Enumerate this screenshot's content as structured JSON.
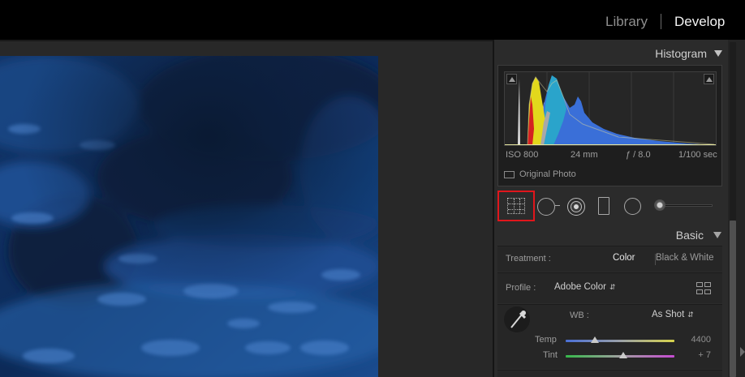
{
  "modules": {
    "library": "Library",
    "develop": "Develop"
  },
  "histogram": {
    "title": "Histogram",
    "iso": "ISO 800",
    "focal": "24 mm",
    "aperture": "ƒ / 8.0",
    "shutter": "1/100 sec",
    "original_photo_label": "Original Photo"
  },
  "tools": {
    "crop": "crop-overlay-icon",
    "spot": "spot-removal-icon",
    "redeye": "red-eye-icon",
    "graduated": "graduated-filter-icon",
    "radial": "radial-filter-icon",
    "brush": "adjustment-brush-icon"
  },
  "basic": {
    "title": "Basic",
    "treatment_label": "Treatment :",
    "treatment_color": "Color",
    "treatment_bw": "Black & White",
    "profile_label": "Profile :",
    "profile_value": "Adobe Color",
    "wb_label": "WB :",
    "wb_value": "As Shot",
    "temp_label": "Temp",
    "temp_value": "4400",
    "tint_label": "Tint",
    "tint_value": "+ 7",
    "temp_level": 0.27,
    "tint_level": 0.53
  },
  "colors": {
    "crop_highlight": "#e0161c",
    "histogram_blue": "#3a6fd8",
    "histogram_yellow": "#e2d81c"
  }
}
